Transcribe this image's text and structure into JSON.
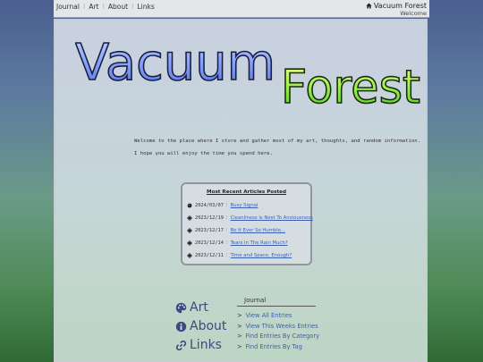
{
  "topnav": {
    "items": [
      "Journal",
      "Art",
      "About",
      "Links"
    ],
    "separator": "⁝"
  },
  "brand": {
    "title": "Vacuum Forest",
    "subtitle": "Welcome"
  },
  "logo": {
    "word1": "Vacuum",
    "word2": "Forest"
  },
  "welcome": {
    "line1": "Welcome to the place where I store and gather most of my art, thoughts, and random information.",
    "line2": "I hope you will enjoy the time you spend here."
  },
  "recent": {
    "title": "Most Recent Articles Posted",
    "separator": "⁝",
    "entries": [
      {
        "icon": "dark-circle-icon",
        "date": "2024/03/07",
        "title": "Busy Signal"
      },
      {
        "icon": "burst-icon",
        "date": "2023/12/19",
        "title": "Cleanliness Is Next To Anxiousness"
      },
      {
        "icon": "burst-icon",
        "date": "2023/12/17",
        "title": "Be It Ever So Humble..."
      },
      {
        "icon": "burst-icon",
        "date": "2023/12/14",
        "title": "Tears In The Rain Much?"
      },
      {
        "icon": "burst-icon",
        "date": "2023/12/11",
        "title": "Time and Space, Enough?"
      }
    ]
  },
  "bignav": {
    "art": "Art",
    "about": "About",
    "links": "Links"
  },
  "journal": {
    "title": "Journal",
    "chevron": ">",
    "links": [
      "View All Entries",
      "View This Weeks Entries",
      "Find Entries By Category",
      "Find Entries By Tag"
    ]
  },
  "colors": {
    "accent_blue": "#6d8df0",
    "accent_green": "#7ee05a",
    "link": "#3b5fb0"
  }
}
